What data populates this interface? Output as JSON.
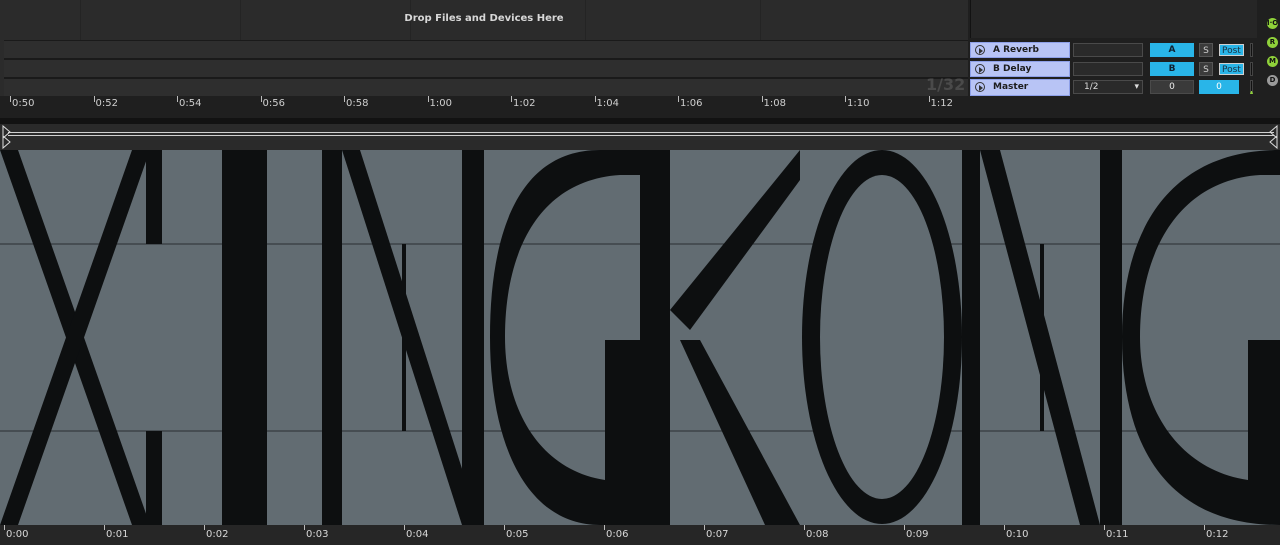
{
  "arrangement": {
    "drop_text": "Drop Files and Devices Here",
    "grid_label": "1/32",
    "time_labels": [
      "0:50",
      "0:52",
      "0:54",
      "0:56",
      "0:58",
      "1:00",
      "1:02",
      "1:04",
      "1:06",
      "1:08",
      "1:10",
      "1:12"
    ]
  },
  "returns": [
    {
      "name": "A Reverb",
      "send_label": "A",
      "solo": "S",
      "monitor": "Post"
    },
    {
      "name": "B Delay",
      "send_label": "B",
      "solo": "S",
      "monitor": "Post"
    }
  ],
  "master": {
    "name": "Master",
    "cue_select": "1/2",
    "volume_left": "0",
    "volume_right": "0"
  },
  "side_indicators": [
    "I·O",
    "R",
    "M",
    "D"
  ],
  "clip": {
    "time_labels": [
      "0:00",
      "0:01",
      "0:02",
      "0:03",
      "0:04",
      "0:05",
      "0:06",
      "0:07",
      "0:08",
      "0:09",
      "0:10",
      "0:11",
      "0:12"
    ]
  },
  "colors": {
    "return_track": "#b8c4f5",
    "send_active": "#29b5e8",
    "indicator_green": "#8fd13a",
    "waveform_bg": "#626c72",
    "waveform": "#0d0f10"
  }
}
